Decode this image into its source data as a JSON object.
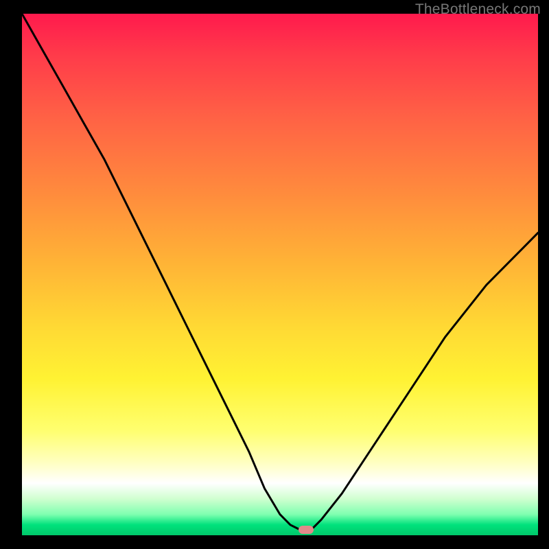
{
  "watermark": "TheBottleneck.com",
  "chart_data": {
    "type": "line",
    "title": "",
    "xlabel": "",
    "ylabel": "",
    "xlim": [
      0,
      100
    ],
    "ylim": [
      0,
      100
    ],
    "grid": false,
    "legend": false,
    "series": [
      {
        "name": "bottleneck-curve",
        "x": [
          0,
          4,
          8,
          12,
          16,
          20,
          24,
          28,
          32,
          36,
          40,
          44,
          47,
          50,
          52,
          54,
          55,
          56,
          58,
          62,
          66,
          70,
          74,
          78,
          82,
          86,
          90,
          94,
          98,
          100
        ],
        "values": [
          100,
          93,
          86,
          79,
          72,
          64,
          56,
          48,
          40,
          32,
          24,
          16,
          9,
          4,
          2,
          1,
          1,
          1,
          3,
          8,
          14,
          20,
          26,
          32,
          38,
          43,
          48,
          52,
          56,
          58
        ]
      }
    ],
    "marker": {
      "x": 55,
      "y": 1
    },
    "colors": {
      "curve": "#000000",
      "marker": "#e08a8a",
      "gradient_stops": [
        "#ff1a4d",
        "#ff8a3d",
        "#ffd934",
        "#ffffff",
        "#00c86a"
      ]
    }
  }
}
